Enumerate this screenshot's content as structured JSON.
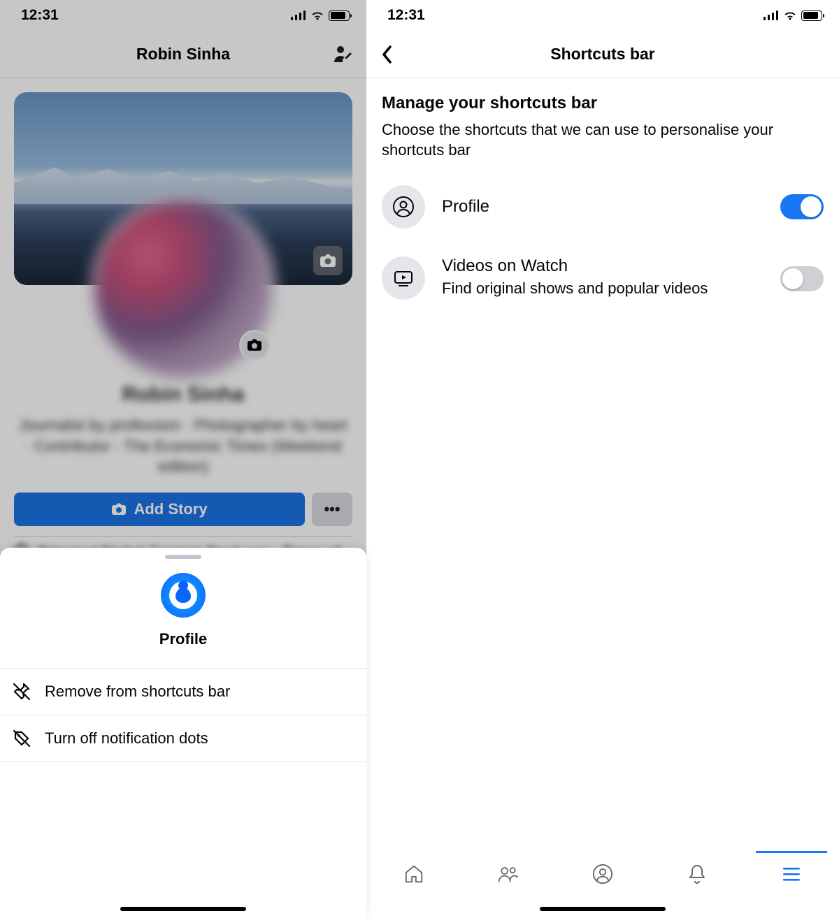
{
  "left": {
    "status_time": "12:31",
    "header_title": "Robin Sinha",
    "profile_name": "Robin Sinha",
    "profile_bio": "Journalist by profession · Photographer by heart · Contributor - The Economic Times (Weekend edition)",
    "add_story_label": "Add Story",
    "work_line": "Principal Digital Content Producer · Times of",
    "sheet": {
      "title": "Profile",
      "item1": "Remove from shortcuts bar",
      "item2": "Turn off notification dots"
    }
  },
  "right": {
    "status_time": "12:31",
    "header_title": "Shortcuts bar",
    "section_title": "Manage your shortcuts bar",
    "section_sub": "Choose the shortcuts that we can use to personalise your shortcuts bar",
    "opt1": {
      "label": "Profile"
    },
    "opt2": {
      "label": "Videos on Watch",
      "desc": "Find original shows and popular videos"
    }
  }
}
